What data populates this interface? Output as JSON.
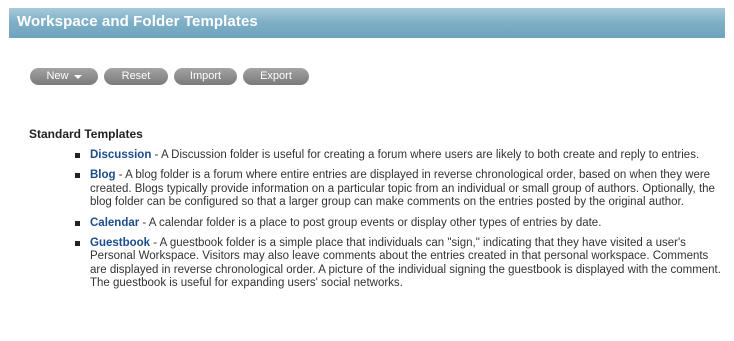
{
  "header": {
    "title": "Workspace and Folder Templates"
  },
  "toolbar": {
    "new_label": "New",
    "reset_label": "Reset",
    "import_label": "Import",
    "export_label": "Export"
  },
  "section": {
    "title": "Standard Templates"
  },
  "templates": [
    {
      "name": "Discussion",
      "description": " - A Discussion folder is useful for creating a forum where users are likely to both create and reply to entries."
    },
    {
      "name": "Blog",
      "description": " - A blog folder is a forum where entire entries are displayed in reverse chronological order, based on when they were created. Blogs typically provide information on a particular topic from an individual or small group of authors. Optionally, the blog folder can be configured so that a larger group can make comments on the entries posted by the original author."
    },
    {
      "name": "Calendar",
      "description": " - A calendar folder is a place to post group events or display other types of entries by date."
    },
    {
      "name": "Guestbook",
      "description": " - A guestbook folder is a simple place that individuals can \"sign,\" indicating that they have visited a user's Personal Workspace. Visitors may also leave comments about the entries created in that personal workspace. Comments are displayed in reverse chronological order. A picture of the individual signing the guestbook is displayed with the comment. The guestbook is useful for expanding users' social networks."
    }
  ],
  "colors": {
    "header_bg": "#7fb0c8",
    "button_bg": "#8c8c8c",
    "link": "#1c4d8a"
  }
}
